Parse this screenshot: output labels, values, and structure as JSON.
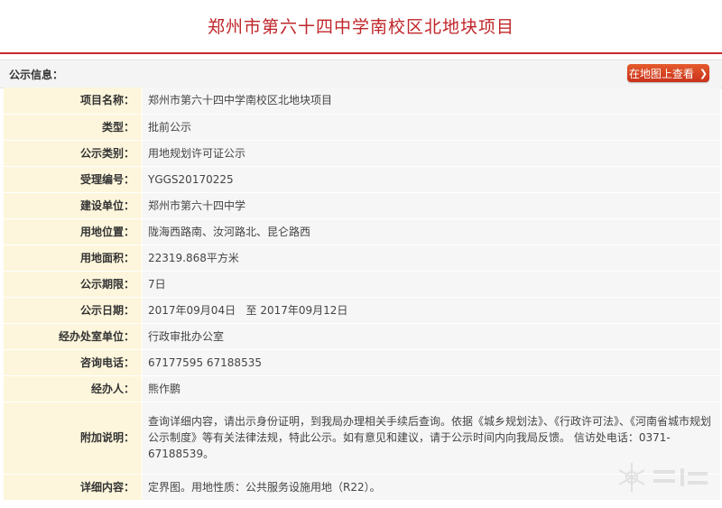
{
  "page_title": "郑州市第六十四中学南校区北地块项目",
  "header": {
    "label": "公示信息：",
    "map_button": "在地图上查看"
  },
  "rows": [
    {
      "label": "项目名称：",
      "value": "郑州市第六十四中学南校区北地块项目"
    },
    {
      "label": "类型：",
      "value": "批前公示"
    },
    {
      "label": "公示类别：",
      "value": "用地规划许可证公示"
    },
    {
      "label": "受理编号：",
      "value": "YGGS20170225"
    },
    {
      "label": "建设单位：",
      "value": "郑州市第六十四中学"
    },
    {
      "label": "用地位置：",
      "value": "陇海西路南、汝河路北、昆仑路西"
    },
    {
      "label": "用地面积：",
      "value": "22319.868平方米"
    },
    {
      "label": "公示期限：",
      "value": "7日"
    },
    {
      "label": "公示日期：",
      "value": "2017年09月04日   至 2017年09月12日"
    },
    {
      "label": "经办处室单位：",
      "value": "行政审批办公室"
    },
    {
      "label": "咨询电话：",
      "value": "67177595 67188535"
    },
    {
      "label": "经办人：",
      "value": "熊作鹏"
    },
    {
      "label": "附加说明：",
      "value": "查询详细内容，请出示身份证明，到我局办理相关手续后查询。依据《城乡规划法》、《行政许可法》、《河南省城市规划公示制度》等有关法律法规，特此公示。如有意见和建议，请于公示时间内向我局反馈。 信访处电话：0371-67188539。"
    },
    {
      "label": "详细内容：",
      "value": "定界图。用地性质：公共服务设施用地（R22）。"
    }
  ],
  "colors": {
    "accent": "#c0262a",
    "label_bg": "#fdf6dc",
    "value_bg": "#f6f6f6",
    "button": "#d4401f"
  },
  "icons": {
    "map_button": "chevron-right-icon",
    "watermark": "snowflake-logo-icon"
  }
}
